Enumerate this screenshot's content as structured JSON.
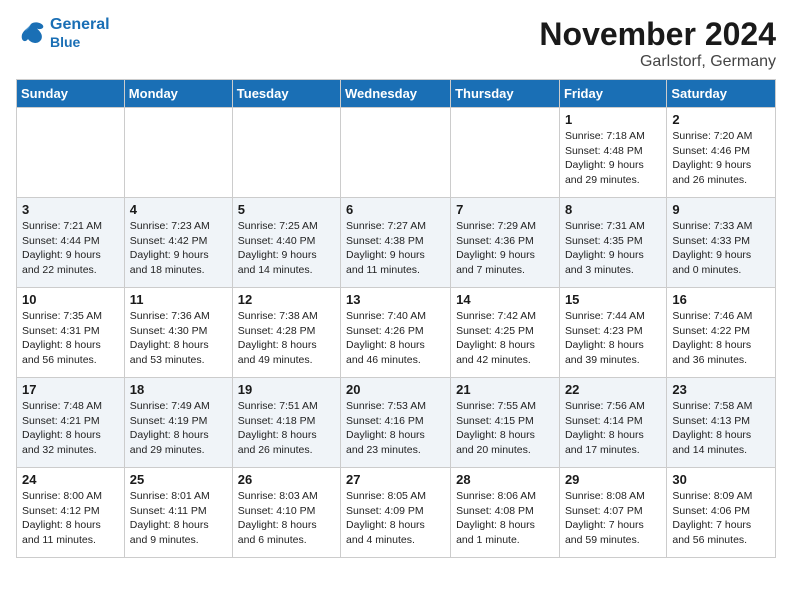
{
  "header": {
    "logo_line1": "General",
    "logo_line2": "Blue",
    "month_title": "November 2024",
    "location": "Garlstorf, Germany"
  },
  "weekdays": [
    "Sunday",
    "Monday",
    "Tuesday",
    "Wednesday",
    "Thursday",
    "Friday",
    "Saturday"
  ],
  "weeks": [
    [
      {
        "day": "",
        "info": ""
      },
      {
        "day": "",
        "info": ""
      },
      {
        "day": "",
        "info": ""
      },
      {
        "day": "",
        "info": ""
      },
      {
        "day": "",
        "info": ""
      },
      {
        "day": "1",
        "info": "Sunrise: 7:18 AM\nSunset: 4:48 PM\nDaylight: 9 hours\nand 29 minutes."
      },
      {
        "day": "2",
        "info": "Sunrise: 7:20 AM\nSunset: 4:46 PM\nDaylight: 9 hours\nand 26 minutes."
      }
    ],
    [
      {
        "day": "3",
        "info": "Sunrise: 7:21 AM\nSunset: 4:44 PM\nDaylight: 9 hours\nand 22 minutes."
      },
      {
        "day": "4",
        "info": "Sunrise: 7:23 AM\nSunset: 4:42 PM\nDaylight: 9 hours\nand 18 minutes."
      },
      {
        "day": "5",
        "info": "Sunrise: 7:25 AM\nSunset: 4:40 PM\nDaylight: 9 hours\nand 14 minutes."
      },
      {
        "day": "6",
        "info": "Sunrise: 7:27 AM\nSunset: 4:38 PM\nDaylight: 9 hours\nand 11 minutes."
      },
      {
        "day": "7",
        "info": "Sunrise: 7:29 AM\nSunset: 4:36 PM\nDaylight: 9 hours\nand 7 minutes."
      },
      {
        "day": "8",
        "info": "Sunrise: 7:31 AM\nSunset: 4:35 PM\nDaylight: 9 hours\nand 3 minutes."
      },
      {
        "day": "9",
        "info": "Sunrise: 7:33 AM\nSunset: 4:33 PM\nDaylight: 9 hours\nand 0 minutes."
      }
    ],
    [
      {
        "day": "10",
        "info": "Sunrise: 7:35 AM\nSunset: 4:31 PM\nDaylight: 8 hours\nand 56 minutes."
      },
      {
        "day": "11",
        "info": "Sunrise: 7:36 AM\nSunset: 4:30 PM\nDaylight: 8 hours\nand 53 minutes."
      },
      {
        "day": "12",
        "info": "Sunrise: 7:38 AM\nSunset: 4:28 PM\nDaylight: 8 hours\nand 49 minutes."
      },
      {
        "day": "13",
        "info": "Sunrise: 7:40 AM\nSunset: 4:26 PM\nDaylight: 8 hours\nand 46 minutes."
      },
      {
        "day": "14",
        "info": "Sunrise: 7:42 AM\nSunset: 4:25 PM\nDaylight: 8 hours\nand 42 minutes."
      },
      {
        "day": "15",
        "info": "Sunrise: 7:44 AM\nSunset: 4:23 PM\nDaylight: 8 hours\nand 39 minutes."
      },
      {
        "day": "16",
        "info": "Sunrise: 7:46 AM\nSunset: 4:22 PM\nDaylight: 8 hours\nand 36 minutes."
      }
    ],
    [
      {
        "day": "17",
        "info": "Sunrise: 7:48 AM\nSunset: 4:21 PM\nDaylight: 8 hours\nand 32 minutes."
      },
      {
        "day": "18",
        "info": "Sunrise: 7:49 AM\nSunset: 4:19 PM\nDaylight: 8 hours\nand 29 minutes."
      },
      {
        "day": "19",
        "info": "Sunrise: 7:51 AM\nSunset: 4:18 PM\nDaylight: 8 hours\nand 26 minutes."
      },
      {
        "day": "20",
        "info": "Sunrise: 7:53 AM\nSunset: 4:16 PM\nDaylight: 8 hours\nand 23 minutes."
      },
      {
        "day": "21",
        "info": "Sunrise: 7:55 AM\nSunset: 4:15 PM\nDaylight: 8 hours\nand 20 minutes."
      },
      {
        "day": "22",
        "info": "Sunrise: 7:56 AM\nSunset: 4:14 PM\nDaylight: 8 hours\nand 17 minutes."
      },
      {
        "day": "23",
        "info": "Sunrise: 7:58 AM\nSunset: 4:13 PM\nDaylight: 8 hours\nand 14 minutes."
      }
    ],
    [
      {
        "day": "24",
        "info": "Sunrise: 8:00 AM\nSunset: 4:12 PM\nDaylight: 8 hours\nand 11 minutes."
      },
      {
        "day": "25",
        "info": "Sunrise: 8:01 AM\nSunset: 4:11 PM\nDaylight: 8 hours\nand 9 minutes."
      },
      {
        "day": "26",
        "info": "Sunrise: 8:03 AM\nSunset: 4:10 PM\nDaylight: 8 hours\nand 6 minutes."
      },
      {
        "day": "27",
        "info": "Sunrise: 8:05 AM\nSunset: 4:09 PM\nDaylight: 8 hours\nand 4 minutes."
      },
      {
        "day": "28",
        "info": "Sunrise: 8:06 AM\nSunset: 4:08 PM\nDaylight: 8 hours\nand 1 minute."
      },
      {
        "day": "29",
        "info": "Sunrise: 8:08 AM\nSunset: 4:07 PM\nDaylight: 7 hours\nand 59 minutes."
      },
      {
        "day": "30",
        "info": "Sunrise: 8:09 AM\nSunset: 4:06 PM\nDaylight: 7 hours\nand 56 minutes."
      }
    ]
  ]
}
